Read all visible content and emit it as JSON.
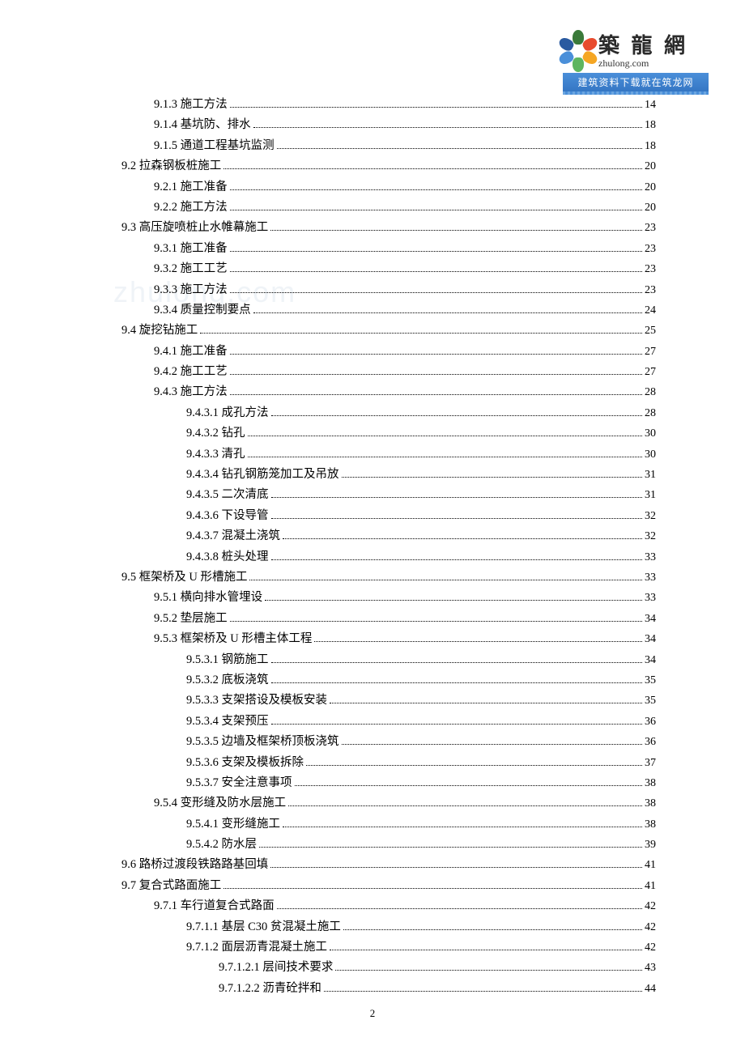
{
  "logo": {
    "cn": "築 龍 網",
    "en": "zhulong.com",
    "banner": "建筑资料下载就在筑龙网"
  },
  "watermark": "zhulong.com",
  "page_number": "2",
  "toc": [
    {
      "indent": 2,
      "num": "9.1.3",
      "title": "施工方法",
      "page": "14"
    },
    {
      "indent": 2,
      "num": "9.1.4",
      "title": "基坑防、排水",
      "page": "18"
    },
    {
      "indent": 2,
      "num": "9.1.5",
      "title": "通道工程基坑监测",
      "page": "18"
    },
    {
      "indent": 1,
      "num": "9.2",
      "title": "拉森钢板桩施工",
      "page": "20"
    },
    {
      "indent": 2,
      "num": "9.2.1",
      "title": "施工准备",
      "page": "20"
    },
    {
      "indent": 2,
      "num": "9.2.2",
      "title": "施工方法",
      "page": "20"
    },
    {
      "indent": 1,
      "num": "9.3",
      "title": "高压旋喷桩止水帷幕施工",
      "page": "23"
    },
    {
      "indent": 2,
      "num": "9.3.1",
      "title": "施工准备",
      "page": "23"
    },
    {
      "indent": 2,
      "num": "9.3.2",
      "title": "施工工艺",
      "page": "23"
    },
    {
      "indent": 2,
      "num": "9.3.3",
      "title": "施工方法",
      "page": "23"
    },
    {
      "indent": 2,
      "num": "9.3.4",
      "title": "质量控制要点",
      "page": "24"
    },
    {
      "indent": 1,
      "num": "9.4",
      "title": "旋挖钻施工",
      "page": "25"
    },
    {
      "indent": 2,
      "num": "9.4.1",
      "title": "施工准备",
      "page": "27"
    },
    {
      "indent": 2,
      "num": "9.4.2",
      "title": "施工工艺",
      "page": "27"
    },
    {
      "indent": 2,
      "num": "9.4.3",
      "title": "施工方法",
      "page": "28"
    },
    {
      "indent": 3,
      "num": "9.4.3.1",
      "title": "成孔方法",
      "page": "28"
    },
    {
      "indent": 3,
      "num": "9.4.3.2",
      "title": "钻孔",
      "page": "30"
    },
    {
      "indent": 3,
      "num": "9.4.3.3",
      "title": "清孔",
      "page": "30"
    },
    {
      "indent": 3,
      "num": "9.4.3.4",
      "title": "钻孔钢筋笼加工及吊放",
      "page": "31"
    },
    {
      "indent": 3,
      "num": "9.4.3.5",
      "title": " 二次清底",
      "page": "31"
    },
    {
      "indent": 3,
      "num": "9.4.3.6",
      "title": "下设导管",
      "page": "32"
    },
    {
      "indent": 3,
      "num": "9.4.3.7",
      "title": "混凝土浇筑",
      "page": "32"
    },
    {
      "indent": 3,
      "num": "9.4.3.8",
      "title": "桩头处理",
      "page": "33"
    },
    {
      "indent": 1,
      "num": "9.5",
      "title": " 框架桥及 U 形槽施工",
      "page": "33"
    },
    {
      "indent": 2,
      "num": "9.5.1",
      "title": "横向排水管埋设",
      "page": "33"
    },
    {
      "indent": 2,
      "num": "9.5.2",
      "title": "垫层施工",
      "page": "34"
    },
    {
      "indent": 2,
      "num": "9.5.3",
      "title": "框架桥及 U 形槽主体工程",
      "page": "34"
    },
    {
      "indent": 3,
      "num": "9.5.3.1",
      "title": "钢筋施工",
      "page": "34"
    },
    {
      "indent": 3,
      "num": "9.5.3.2",
      "title": "底板浇筑",
      "page": "35"
    },
    {
      "indent": 3,
      "num": "9.5.3.3",
      "title": "支架搭设及模板安装",
      "page": "35"
    },
    {
      "indent": 3,
      "num": "9.5.3.4",
      "title": "支架预压",
      "page": "36"
    },
    {
      "indent": 3,
      "num": "9.5.3.5",
      "title": "边墙及框架桥顶板浇筑",
      "page": "36"
    },
    {
      "indent": 3,
      "num": "9.5.3.6",
      "title": "支架及模板拆除",
      "page": "37"
    },
    {
      "indent": 3,
      "num": "9.5.3.7",
      "title": "安全注意事项",
      "page": "38"
    },
    {
      "indent": 2,
      "num": "9.5.4",
      "title": "变形缝及防水层施工",
      "page": "38"
    },
    {
      "indent": 3,
      "num": "9.5.4.1",
      "title": "变形缝施工",
      "page": "38"
    },
    {
      "indent": 3,
      "num": "9.5.4.2",
      "title": "防水层",
      "page": "39"
    },
    {
      "indent": 1,
      "num": "9.6",
      "title": "路桥过渡段铁路路基回填",
      "page": "41"
    },
    {
      "indent": 1,
      "num": "9.7",
      "title": "复合式路面施工",
      "page": "41"
    },
    {
      "indent": 2,
      "num": "9.7.1",
      "title": "车行道复合式路面",
      "page": "42"
    },
    {
      "indent": 3,
      "num": "9.7.1.1",
      "title": "基层 C30 贫混凝土施工",
      "page": "42"
    },
    {
      "indent": 3,
      "num": "9.7.1.2",
      "title": "面层沥青混凝土施工",
      "page": "42"
    },
    {
      "indent": 4,
      "num": "9.7.1.2.1",
      "title": "层间技术要求",
      "page": "43"
    },
    {
      "indent": 4,
      "num": "9.7.1.2.2",
      "title": "沥青砼拌和",
      "page": "44"
    }
  ]
}
